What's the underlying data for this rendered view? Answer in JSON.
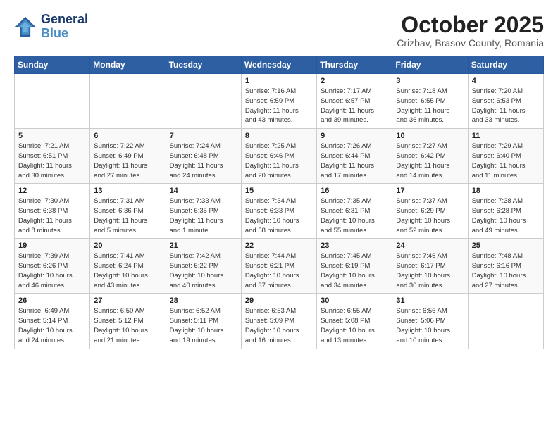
{
  "header": {
    "logo_line1": "General",
    "logo_line2": "Blue",
    "month": "October 2025",
    "location": "Crizbav, Brasov County, Romania"
  },
  "weekdays": [
    "Sunday",
    "Monday",
    "Tuesday",
    "Wednesday",
    "Thursday",
    "Friday",
    "Saturday"
  ],
  "weeks": [
    [
      {
        "day": "",
        "info": ""
      },
      {
        "day": "",
        "info": ""
      },
      {
        "day": "",
        "info": ""
      },
      {
        "day": "1",
        "info": "Sunrise: 7:16 AM\nSunset: 6:59 PM\nDaylight: 11 hours\nand 43 minutes."
      },
      {
        "day": "2",
        "info": "Sunrise: 7:17 AM\nSunset: 6:57 PM\nDaylight: 11 hours\nand 39 minutes."
      },
      {
        "day": "3",
        "info": "Sunrise: 7:18 AM\nSunset: 6:55 PM\nDaylight: 11 hours\nand 36 minutes."
      },
      {
        "day": "4",
        "info": "Sunrise: 7:20 AM\nSunset: 6:53 PM\nDaylight: 11 hours\nand 33 minutes."
      }
    ],
    [
      {
        "day": "5",
        "info": "Sunrise: 7:21 AM\nSunset: 6:51 PM\nDaylight: 11 hours\nand 30 minutes."
      },
      {
        "day": "6",
        "info": "Sunrise: 7:22 AM\nSunset: 6:49 PM\nDaylight: 11 hours\nand 27 minutes."
      },
      {
        "day": "7",
        "info": "Sunrise: 7:24 AM\nSunset: 6:48 PM\nDaylight: 11 hours\nand 24 minutes."
      },
      {
        "day": "8",
        "info": "Sunrise: 7:25 AM\nSunset: 6:46 PM\nDaylight: 11 hours\nand 20 minutes."
      },
      {
        "day": "9",
        "info": "Sunrise: 7:26 AM\nSunset: 6:44 PM\nDaylight: 11 hours\nand 17 minutes."
      },
      {
        "day": "10",
        "info": "Sunrise: 7:27 AM\nSunset: 6:42 PM\nDaylight: 11 hours\nand 14 minutes."
      },
      {
        "day": "11",
        "info": "Sunrise: 7:29 AM\nSunset: 6:40 PM\nDaylight: 11 hours\nand 11 minutes."
      }
    ],
    [
      {
        "day": "12",
        "info": "Sunrise: 7:30 AM\nSunset: 6:38 PM\nDaylight: 11 hours\nand 8 minutes."
      },
      {
        "day": "13",
        "info": "Sunrise: 7:31 AM\nSunset: 6:36 PM\nDaylight: 11 hours\nand 5 minutes."
      },
      {
        "day": "14",
        "info": "Sunrise: 7:33 AM\nSunset: 6:35 PM\nDaylight: 11 hours\nand 1 minute."
      },
      {
        "day": "15",
        "info": "Sunrise: 7:34 AM\nSunset: 6:33 PM\nDaylight: 10 hours\nand 58 minutes."
      },
      {
        "day": "16",
        "info": "Sunrise: 7:35 AM\nSunset: 6:31 PM\nDaylight: 10 hours\nand 55 minutes."
      },
      {
        "day": "17",
        "info": "Sunrise: 7:37 AM\nSunset: 6:29 PM\nDaylight: 10 hours\nand 52 minutes."
      },
      {
        "day": "18",
        "info": "Sunrise: 7:38 AM\nSunset: 6:28 PM\nDaylight: 10 hours\nand 49 minutes."
      }
    ],
    [
      {
        "day": "19",
        "info": "Sunrise: 7:39 AM\nSunset: 6:26 PM\nDaylight: 10 hours\nand 46 minutes."
      },
      {
        "day": "20",
        "info": "Sunrise: 7:41 AM\nSunset: 6:24 PM\nDaylight: 10 hours\nand 43 minutes."
      },
      {
        "day": "21",
        "info": "Sunrise: 7:42 AM\nSunset: 6:22 PM\nDaylight: 10 hours\nand 40 minutes."
      },
      {
        "day": "22",
        "info": "Sunrise: 7:44 AM\nSunset: 6:21 PM\nDaylight: 10 hours\nand 37 minutes."
      },
      {
        "day": "23",
        "info": "Sunrise: 7:45 AM\nSunset: 6:19 PM\nDaylight: 10 hours\nand 34 minutes."
      },
      {
        "day": "24",
        "info": "Sunrise: 7:46 AM\nSunset: 6:17 PM\nDaylight: 10 hours\nand 30 minutes."
      },
      {
        "day": "25",
        "info": "Sunrise: 7:48 AM\nSunset: 6:16 PM\nDaylight: 10 hours\nand 27 minutes."
      }
    ],
    [
      {
        "day": "26",
        "info": "Sunrise: 6:49 AM\nSunset: 5:14 PM\nDaylight: 10 hours\nand 24 minutes."
      },
      {
        "day": "27",
        "info": "Sunrise: 6:50 AM\nSunset: 5:12 PM\nDaylight: 10 hours\nand 21 minutes."
      },
      {
        "day": "28",
        "info": "Sunrise: 6:52 AM\nSunset: 5:11 PM\nDaylight: 10 hours\nand 19 minutes."
      },
      {
        "day": "29",
        "info": "Sunrise: 6:53 AM\nSunset: 5:09 PM\nDaylight: 10 hours\nand 16 minutes."
      },
      {
        "day": "30",
        "info": "Sunrise: 6:55 AM\nSunset: 5:08 PM\nDaylight: 10 hours\nand 13 minutes."
      },
      {
        "day": "31",
        "info": "Sunrise: 6:56 AM\nSunset: 5:06 PM\nDaylight: 10 hours\nand 10 minutes."
      },
      {
        "day": "",
        "info": ""
      }
    ]
  ]
}
